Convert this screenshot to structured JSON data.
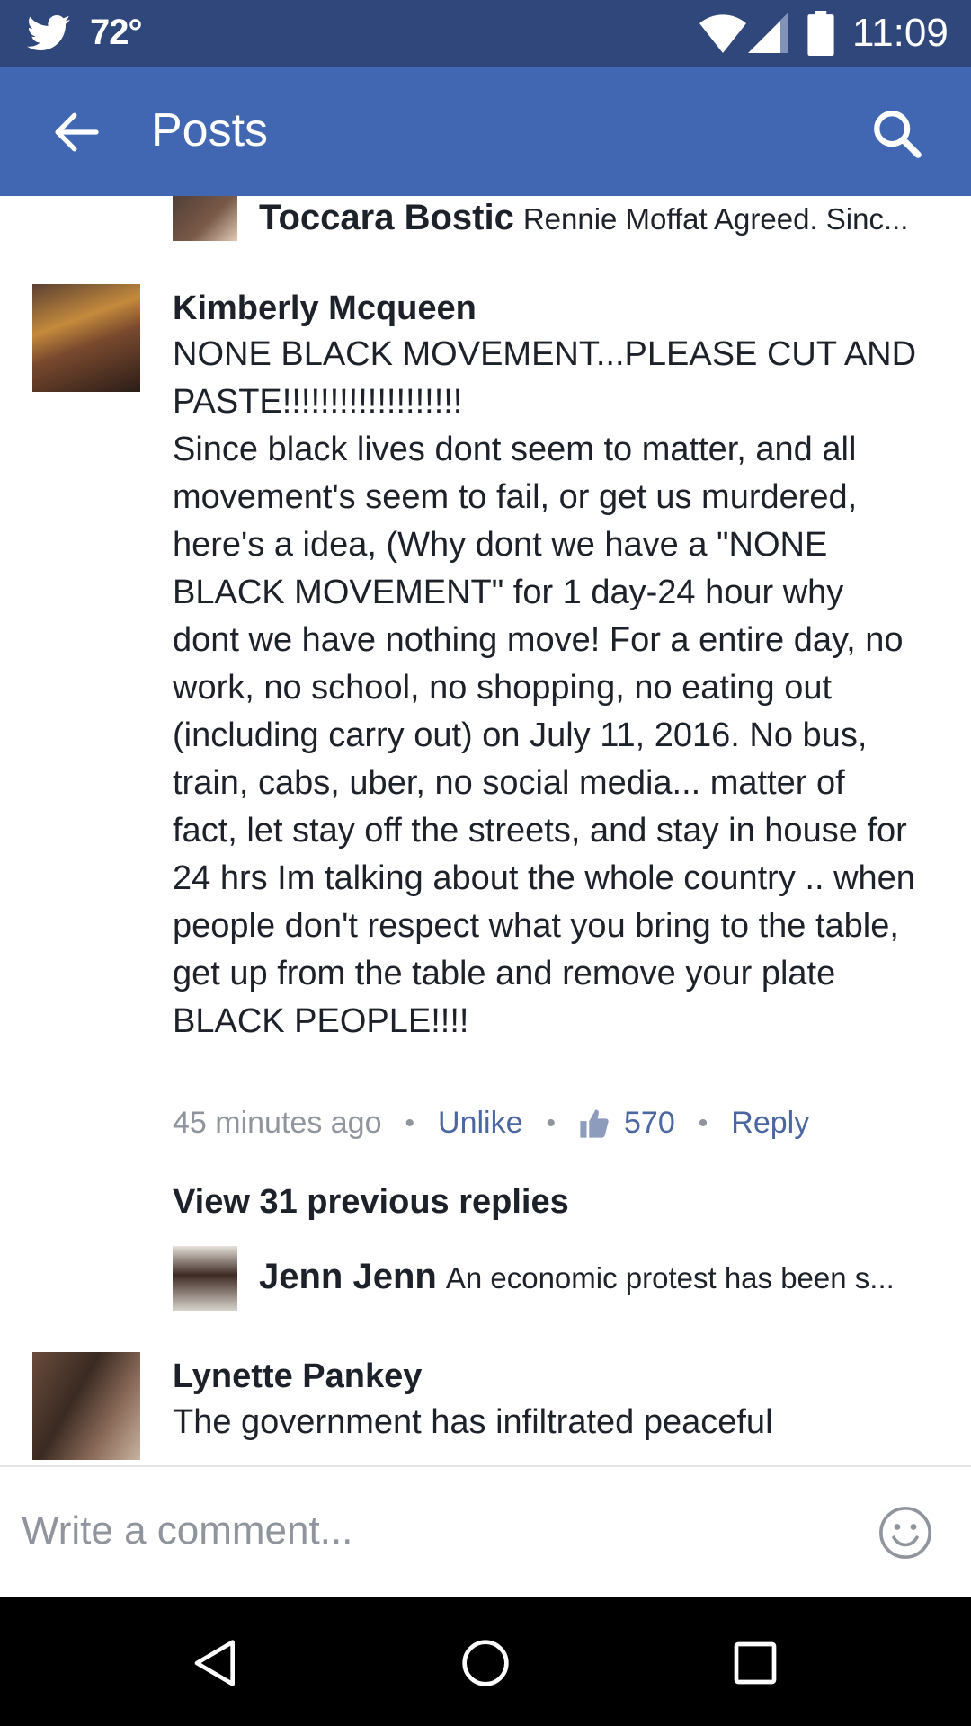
{
  "status_bar": {
    "temperature": "72°",
    "time": "11:09",
    "icons": [
      "twitter-icon",
      "wifi-icon",
      "signal-icon",
      "battery-icon"
    ]
  },
  "app_bar": {
    "title": "Posts",
    "icons": [
      "back-arrow-icon",
      "search-icon"
    ],
    "background": "#4267b2"
  },
  "top_reply": {
    "author": "Toccara Bostic",
    "snippet": "Rennie Moffat Agreed. Sinc..."
  },
  "main_comment": {
    "author": "Kimberly Mcqueen",
    "body": "NONE BLACK MOVEMENT...PLEASE CUT AND PASTE!!!!!!!!!!!!!!!!!!!\nSince black lives dont seem to matter, and all movement's seem to fail, or get us murdered, here's a idea, (Why dont we have a \"NONE BLACK MOVEMENT\" for 1 day-24 hour why dont we have nothing move! For a entire day, no work, no school, no shopping, no eating out (including carry out) on July 11, 2016. No bus, train, cabs, uber, no social media... matter of fact, let stay off the streets, and stay in house for 24 hrs Im talking about the whole country .. when people don't respect what you bring to the table,  get up from the table and remove your plate BLACK PEOPLE!!!!",
    "timestamp": "45 minutes ago",
    "unlike_label": "Unlike",
    "like_count": "570",
    "reply_label": "Reply"
  },
  "view_previous": "View 31 previous replies",
  "reply_jenn": {
    "author": "Jenn Jenn",
    "snippet": "An economic protest has been s..."
  },
  "comment_lynette": {
    "author": "Lynette Pankey",
    "body": "The government has infiltrated peaceful"
  },
  "composer": {
    "placeholder": "Write a comment...",
    "icon": "smiley-icon"
  },
  "nav_bar": {
    "icons": [
      "nav-back-icon",
      "nav-home-icon",
      "nav-recents-icon"
    ]
  }
}
